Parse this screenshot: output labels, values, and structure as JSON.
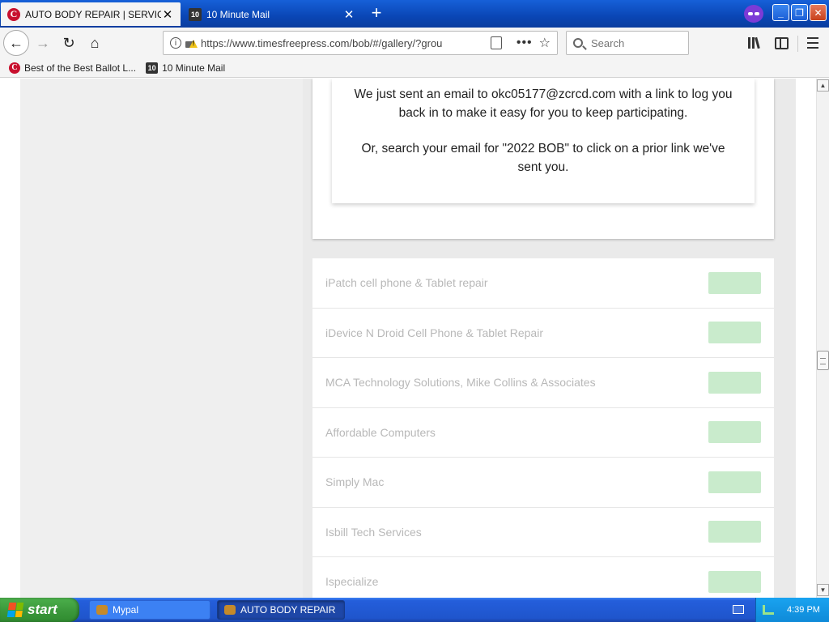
{
  "browser": {
    "tabs": [
      {
        "label": "AUTO BODY REPAIR | SERVICES",
        "active": true,
        "favicon": "times-free-press-c-icon"
      },
      {
        "label": "10 Minute Mail",
        "active": false,
        "favicon": "ten-minute-mail-icon"
      }
    ],
    "new_tab_symbol": "+",
    "close_symbol": "✕",
    "url": "https://www.timesfreepress.com/bob/#/gallery/?grou",
    "search_placeholder": "Search",
    "window_controls": {
      "minimize": "_",
      "maximize": "❐",
      "close": "✕"
    }
  },
  "bookmarks": [
    {
      "label": "Best of the Best Ballot L...",
      "icon": "times-free-press-c-icon"
    },
    {
      "label": "10 Minute Mail",
      "icon": "ten-minute-mail-icon"
    }
  ],
  "email_notice": {
    "paragraph1": "We just sent an email to okc05177@zcrcd.com with a link to log you back in to make it easy for you to keep participating.",
    "paragraph2": "Or, search your email for \"2022 BOB\" to click on a prior link we've sent you."
  },
  "businesses": [
    "iPatch cell phone & Tablet repair",
    "iDevice N Droid Cell Phone & Tablet Repair",
    "MCA Technology Solutions, Mike Collins & Associates",
    "Affordable Computers",
    "Simply Mac",
    "Isbill Tech Services",
    "Ispecialize"
  ],
  "colors": {
    "vote_button": "#c9ebcc",
    "business_text": "#b8b8b8",
    "taskbar": "#245edb"
  },
  "taskbar": {
    "start_label": "start",
    "tasks": [
      {
        "label": "Mypal"
      },
      {
        "label": "AUTO BODY REPAIR ..."
      }
    ],
    "clock": "4:39 PM"
  }
}
